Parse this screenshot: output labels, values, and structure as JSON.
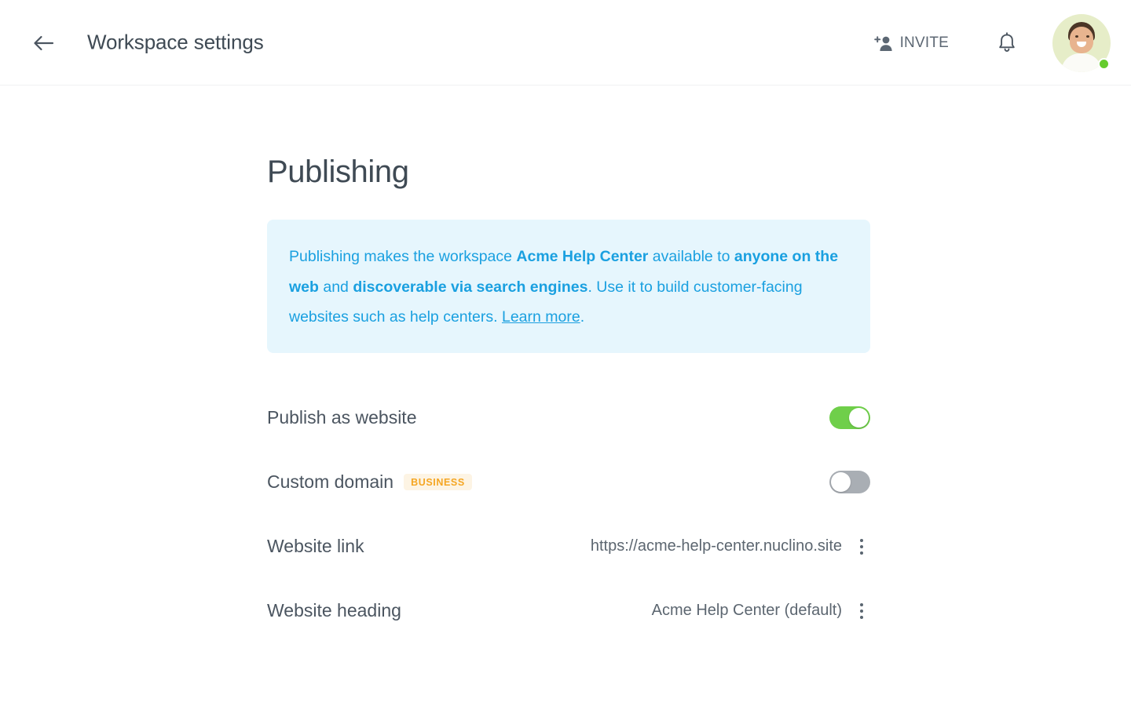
{
  "header": {
    "back_icon": "arrow-left-icon",
    "title": "Workspace settings",
    "invite_label": "INVITE",
    "invite_icon": "person-add-icon",
    "bell_icon": "bell-icon",
    "avatar_icon": "avatar",
    "status": "online"
  },
  "main": {
    "section_title": "Publishing",
    "banner": {
      "part1": "Publishing makes the workspace ",
      "bold1": "Acme Help Center",
      "part2": " available to ",
      "bold2": "anyone on the web",
      "part3": " and ",
      "bold3": "discoverable via search engines",
      "part4": ". Use it to build customer-facing websites such as help centers. ",
      "link": "Learn more",
      "part5": "."
    },
    "rows": [
      {
        "label": "Publish as website",
        "badge": "",
        "control": "toggle",
        "value": "",
        "toggle_state": "on"
      },
      {
        "label": "Custom domain",
        "badge": "BUSINESS",
        "control": "toggle",
        "value": "",
        "toggle_state": "off"
      },
      {
        "label": "Website link",
        "badge": "",
        "control": "menu",
        "value": "https://acme-help-center.nuclino.site",
        "toggle_state": ""
      },
      {
        "label": "Website heading",
        "badge": "",
        "control": "menu",
        "value": "Acme Help Center (default)",
        "toggle_state": ""
      }
    ]
  },
  "colors": {
    "accent_blue": "#1aa0e0",
    "banner_bg": "#e6f6fd",
    "toggle_on": "#6fcf4a",
    "toggle_off": "#a9aeb4",
    "badge_text": "#f5a623",
    "badge_bg": "#fdf4e4",
    "text_primary": "#3f4a54",
    "text_secondary": "#5c6670",
    "status_green": "#65cc2e"
  }
}
